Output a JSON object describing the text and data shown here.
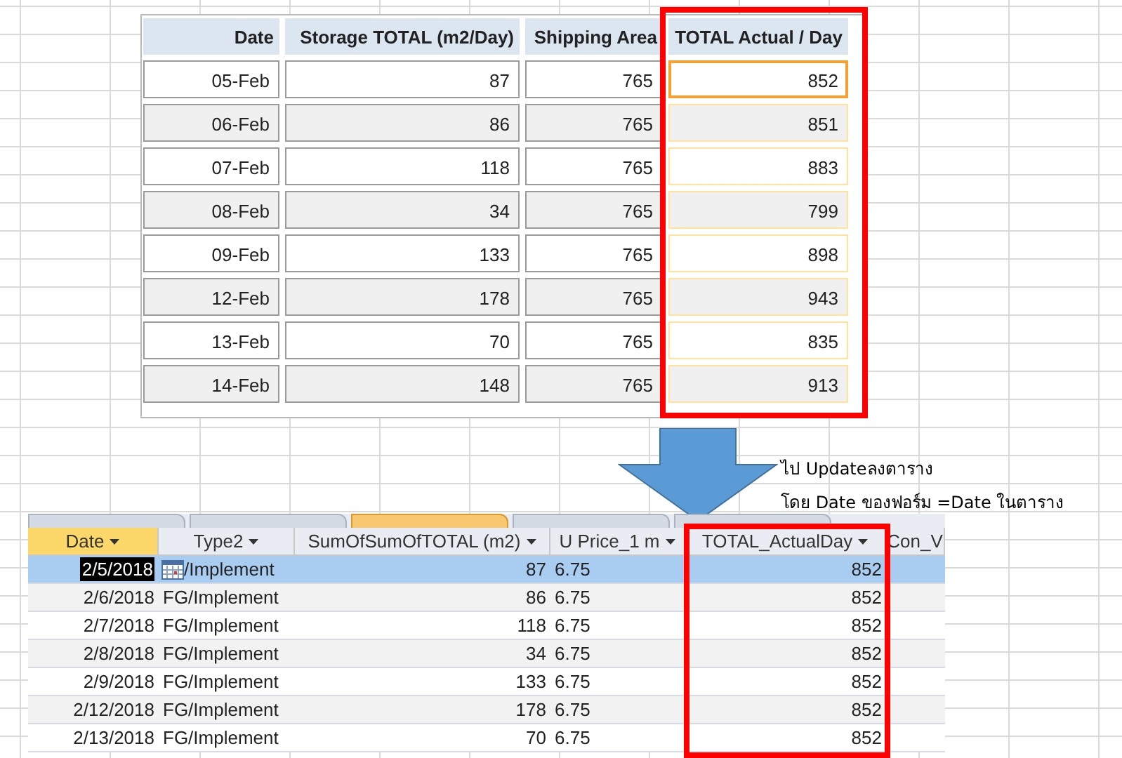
{
  "form_table": {
    "columns": [
      "Date",
      "Storage TOTAL (m2/Day)",
      "Shipping Area",
      "TOTAL  Actual / Day"
    ],
    "rows": [
      {
        "date": "05-Feb",
        "storage": "87",
        "shipping": "765",
        "total": "852",
        "active": true
      },
      {
        "date": "06-Feb",
        "storage": "86",
        "shipping": "765",
        "total": "851",
        "active": false
      },
      {
        "date": "07-Feb",
        "storage": "118",
        "shipping": "765",
        "total": "883",
        "active": false
      },
      {
        "date": "08-Feb",
        "storage": "34",
        "shipping": "765",
        "total": "799",
        "active": false
      },
      {
        "date": "09-Feb",
        "storage": "133",
        "shipping": "765",
        "total": "898",
        "active": false
      },
      {
        "date": "12-Feb",
        "storage": "178",
        "shipping": "765",
        "total": "943",
        "active": false
      },
      {
        "date": "13-Feb",
        "storage": "70",
        "shipping": "765",
        "total": "835",
        "active": false
      },
      {
        "date": "14-Feb",
        "storage": "148",
        "shipping": "765",
        "total": "913",
        "active": false
      }
    ]
  },
  "callout": [
    "ไป Updateลงตาราง",
    "โดย Date ของฟอร์ม =Date ในตาราง"
  ],
  "datasheet": {
    "tabs": [
      {
        "selected": false
      },
      {
        "selected": false
      },
      {
        "selected": true
      },
      {
        "selected": false
      },
      {
        "selected": false
      }
    ],
    "columns": [
      {
        "label": "Date",
        "sorted": true
      },
      {
        "label": "Type2",
        "sorted": false
      },
      {
        "label": "SumOfSumOfTOTAL (m2)",
        "sorted": false
      },
      {
        "label": "U Price_1 m",
        "sorted": false
      },
      {
        "label": "TOTAL_ActualDay",
        "sorted": false
      },
      {
        "label": "Con_V",
        "sorted": false
      }
    ],
    "rows": [
      {
        "date": "2/5/2018",
        "type2": "/Implement",
        "sum": "87",
        "price": "6.75",
        "total": "852",
        "selected": true
      },
      {
        "date": "2/6/2018",
        "type2": "FG/Implement",
        "sum": "86",
        "price": "6.75",
        "total": "852",
        "selected": false
      },
      {
        "date": "2/7/2018",
        "type2": "FG/Implement",
        "sum": "118",
        "price": "6.75",
        "total": "852",
        "selected": false
      },
      {
        "date": "2/8/2018",
        "type2": "FG/Implement",
        "sum": "34",
        "price": "6.75",
        "total": "852",
        "selected": false
      },
      {
        "date": "2/9/2018",
        "type2": "FG/Implement",
        "sum": "133",
        "price": "6.75",
        "total": "852",
        "selected": false
      },
      {
        "date": "2/12/2018",
        "type2": "FG/Implement",
        "sum": "178",
        "price": "6.75",
        "total": "852",
        "selected": false
      },
      {
        "date": "2/13/2018",
        "type2": "FG/Implement",
        "sum": "70",
        "price": "6.75",
        "total": "852",
        "selected": false
      }
    ]
  }
}
